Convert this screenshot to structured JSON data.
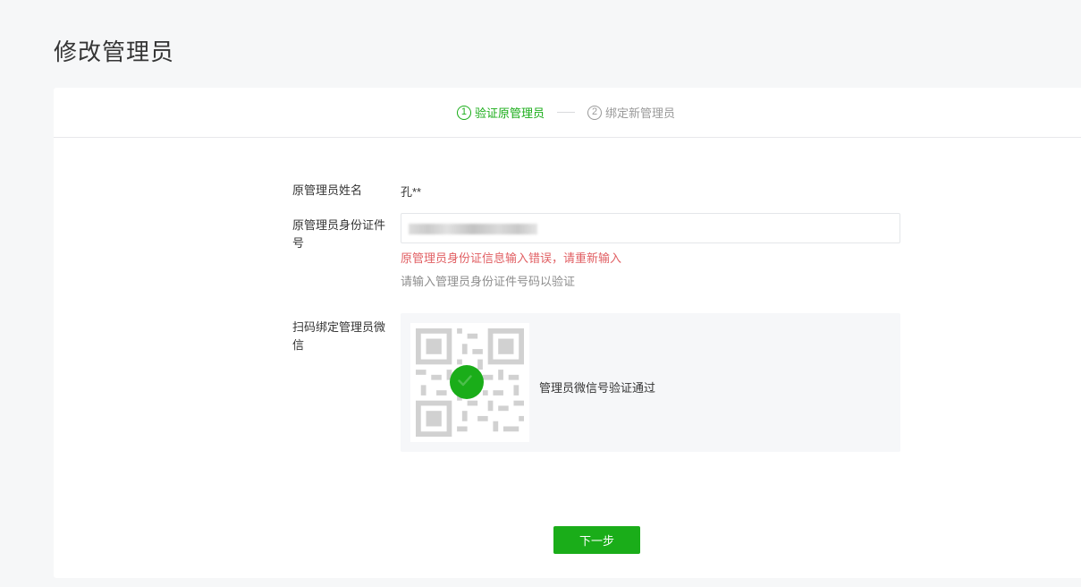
{
  "page": {
    "title": "修改管理员"
  },
  "steps": [
    {
      "number": "1",
      "label": "验证原管理员",
      "state": "active"
    },
    {
      "number": "2",
      "label": "绑定新管理员",
      "state": "inactive"
    }
  ],
  "form": {
    "name": {
      "label": "原管理员姓名",
      "value": "孔**"
    },
    "id_number": {
      "label": "原管理员身份证件号",
      "error": "原管理员身份证信息输入错误，请重新输入",
      "hint": "请输入管理员身份证件号码以验证"
    },
    "wechat": {
      "label": "扫码绑定管理员微信",
      "status": "管理员微信号验证通过"
    }
  },
  "actions": {
    "next_label": "下一步"
  },
  "colors": {
    "accent": "#1aad19",
    "error": "#e15f63",
    "hint": "#8d8d8d"
  }
}
